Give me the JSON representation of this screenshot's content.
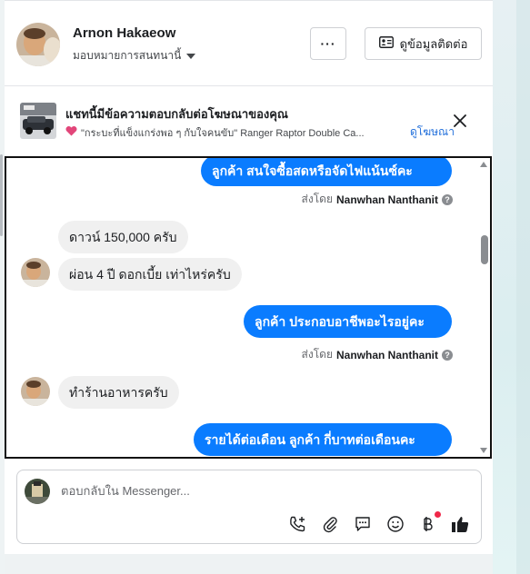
{
  "header": {
    "contact_name": "Arnon Hakaeow",
    "assign_label": "มอบหมายการสนทนานี้",
    "more_label": "···",
    "contact_info_label": "ดูข้อมูลติดต่อ"
  },
  "ad_banner": {
    "title": "แชทนี้มีข้อความตอบกลับต่อโฆษณาของคุณ",
    "subtitle": "\"กระบะที่แข็งแกร่งพอ ๆ กับใจคนขับ\"  Ranger Raptor Double Ca...",
    "link_label": "ดูโฆษณา"
  },
  "messages": [
    {
      "direction": "out",
      "text": "ลูกค้า  สนใจซื้อสดหรือจัดไฟแน้นซ์คะ"
    },
    {
      "direction": "meta",
      "prefix": "ส่งโดย",
      "sender": "Nanwhan Nanthanit"
    },
    {
      "direction": "in",
      "text": "ดาวน์ 150,000 ครับ"
    },
    {
      "direction": "in",
      "text": "ผ่อน 4 ปี ดอกเบี้ย เท่าไหร่ครับ"
    },
    {
      "direction": "out",
      "text": "ลูกค้า  ประกอบอาชีพอะไรอยู่คะ"
    },
    {
      "direction": "meta",
      "prefix": "ส่งโดย",
      "sender": "Nanwhan Nanthanit"
    },
    {
      "direction": "in",
      "text": "ทำร้านอาหารครับ"
    },
    {
      "direction": "out",
      "text": "รายได้ต่อเดือน  ลูกค้า  กี่บาทต่อเดือนคะ"
    }
  ],
  "composer": {
    "placeholder": "ตอบกลับใน Messenger..."
  },
  "toolbar_icons": [
    "call-add-icon",
    "attachment-icon",
    "saved-replies-icon",
    "emoji-icon",
    "baht-payment-icon",
    "like-icon"
  ],
  "colors": {
    "outgoing_bubble": "#0a7cff",
    "incoming_bubble": "#f0f0f0",
    "link": "#216fdb",
    "notification_dot": "#f02849"
  }
}
